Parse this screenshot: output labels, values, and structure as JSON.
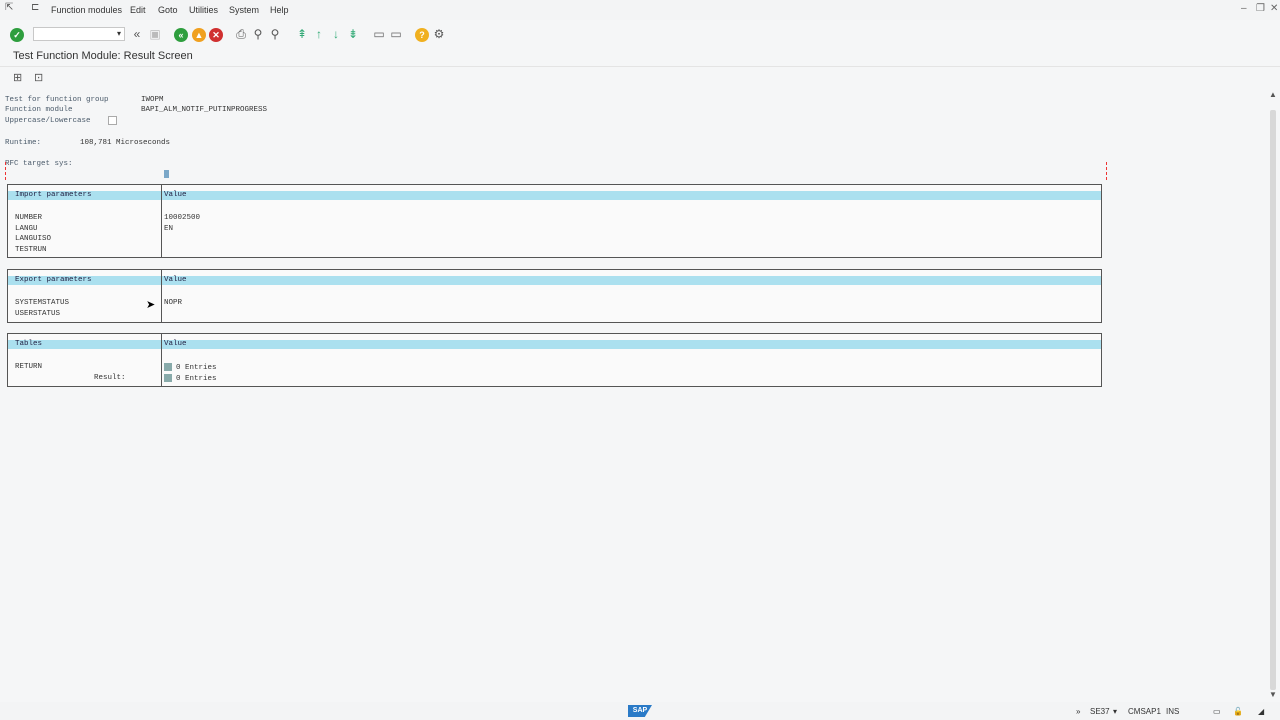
{
  "menubar": {
    "items": [
      "Function modules",
      "Edit",
      "Goto",
      "Utilities",
      "System",
      "Help"
    ]
  },
  "screen": {
    "title": "Test Function Module: Result Screen"
  },
  "info": {
    "function_group_label": "Test for function group",
    "function_group_value": "IWOPM",
    "function_module_label": "Function module",
    "function_module_value": "BAPI_ALM_NOTIF_PUTINPROGRESS",
    "case_label": "Uppercase/Lowercase",
    "runtime_label": "Runtime:",
    "runtime_value": "108,781 Microseconds",
    "rfc_label": "RFC target sys:"
  },
  "import_params": {
    "header_param": "Import parameters",
    "header_value": "Value",
    "rows": [
      {
        "name": "NUMBER",
        "value": "10002500"
      },
      {
        "name": "LANGU",
        "value": "EN"
      },
      {
        "name": "LANGUISO",
        "value": ""
      },
      {
        "name": "TESTRUN",
        "value": ""
      }
    ]
  },
  "export_params": {
    "header_param": "Export parameters",
    "header_value": "Value",
    "rows": [
      {
        "name": "SYSTEMSTATUS",
        "value": "NOPR"
      },
      {
        "name": "USERSTATUS",
        "value": ""
      }
    ]
  },
  "tables": {
    "header_param": "Tables",
    "header_value": "Value",
    "rows": [
      {
        "name": "RETURN",
        "value": "0 Entries"
      },
      {
        "name": "Result:",
        "value": "0 Entries"
      }
    ]
  },
  "status": {
    "transaction": "SE37",
    "system": "CMSAP1",
    "mode": "INS",
    "logo": "SAP"
  }
}
